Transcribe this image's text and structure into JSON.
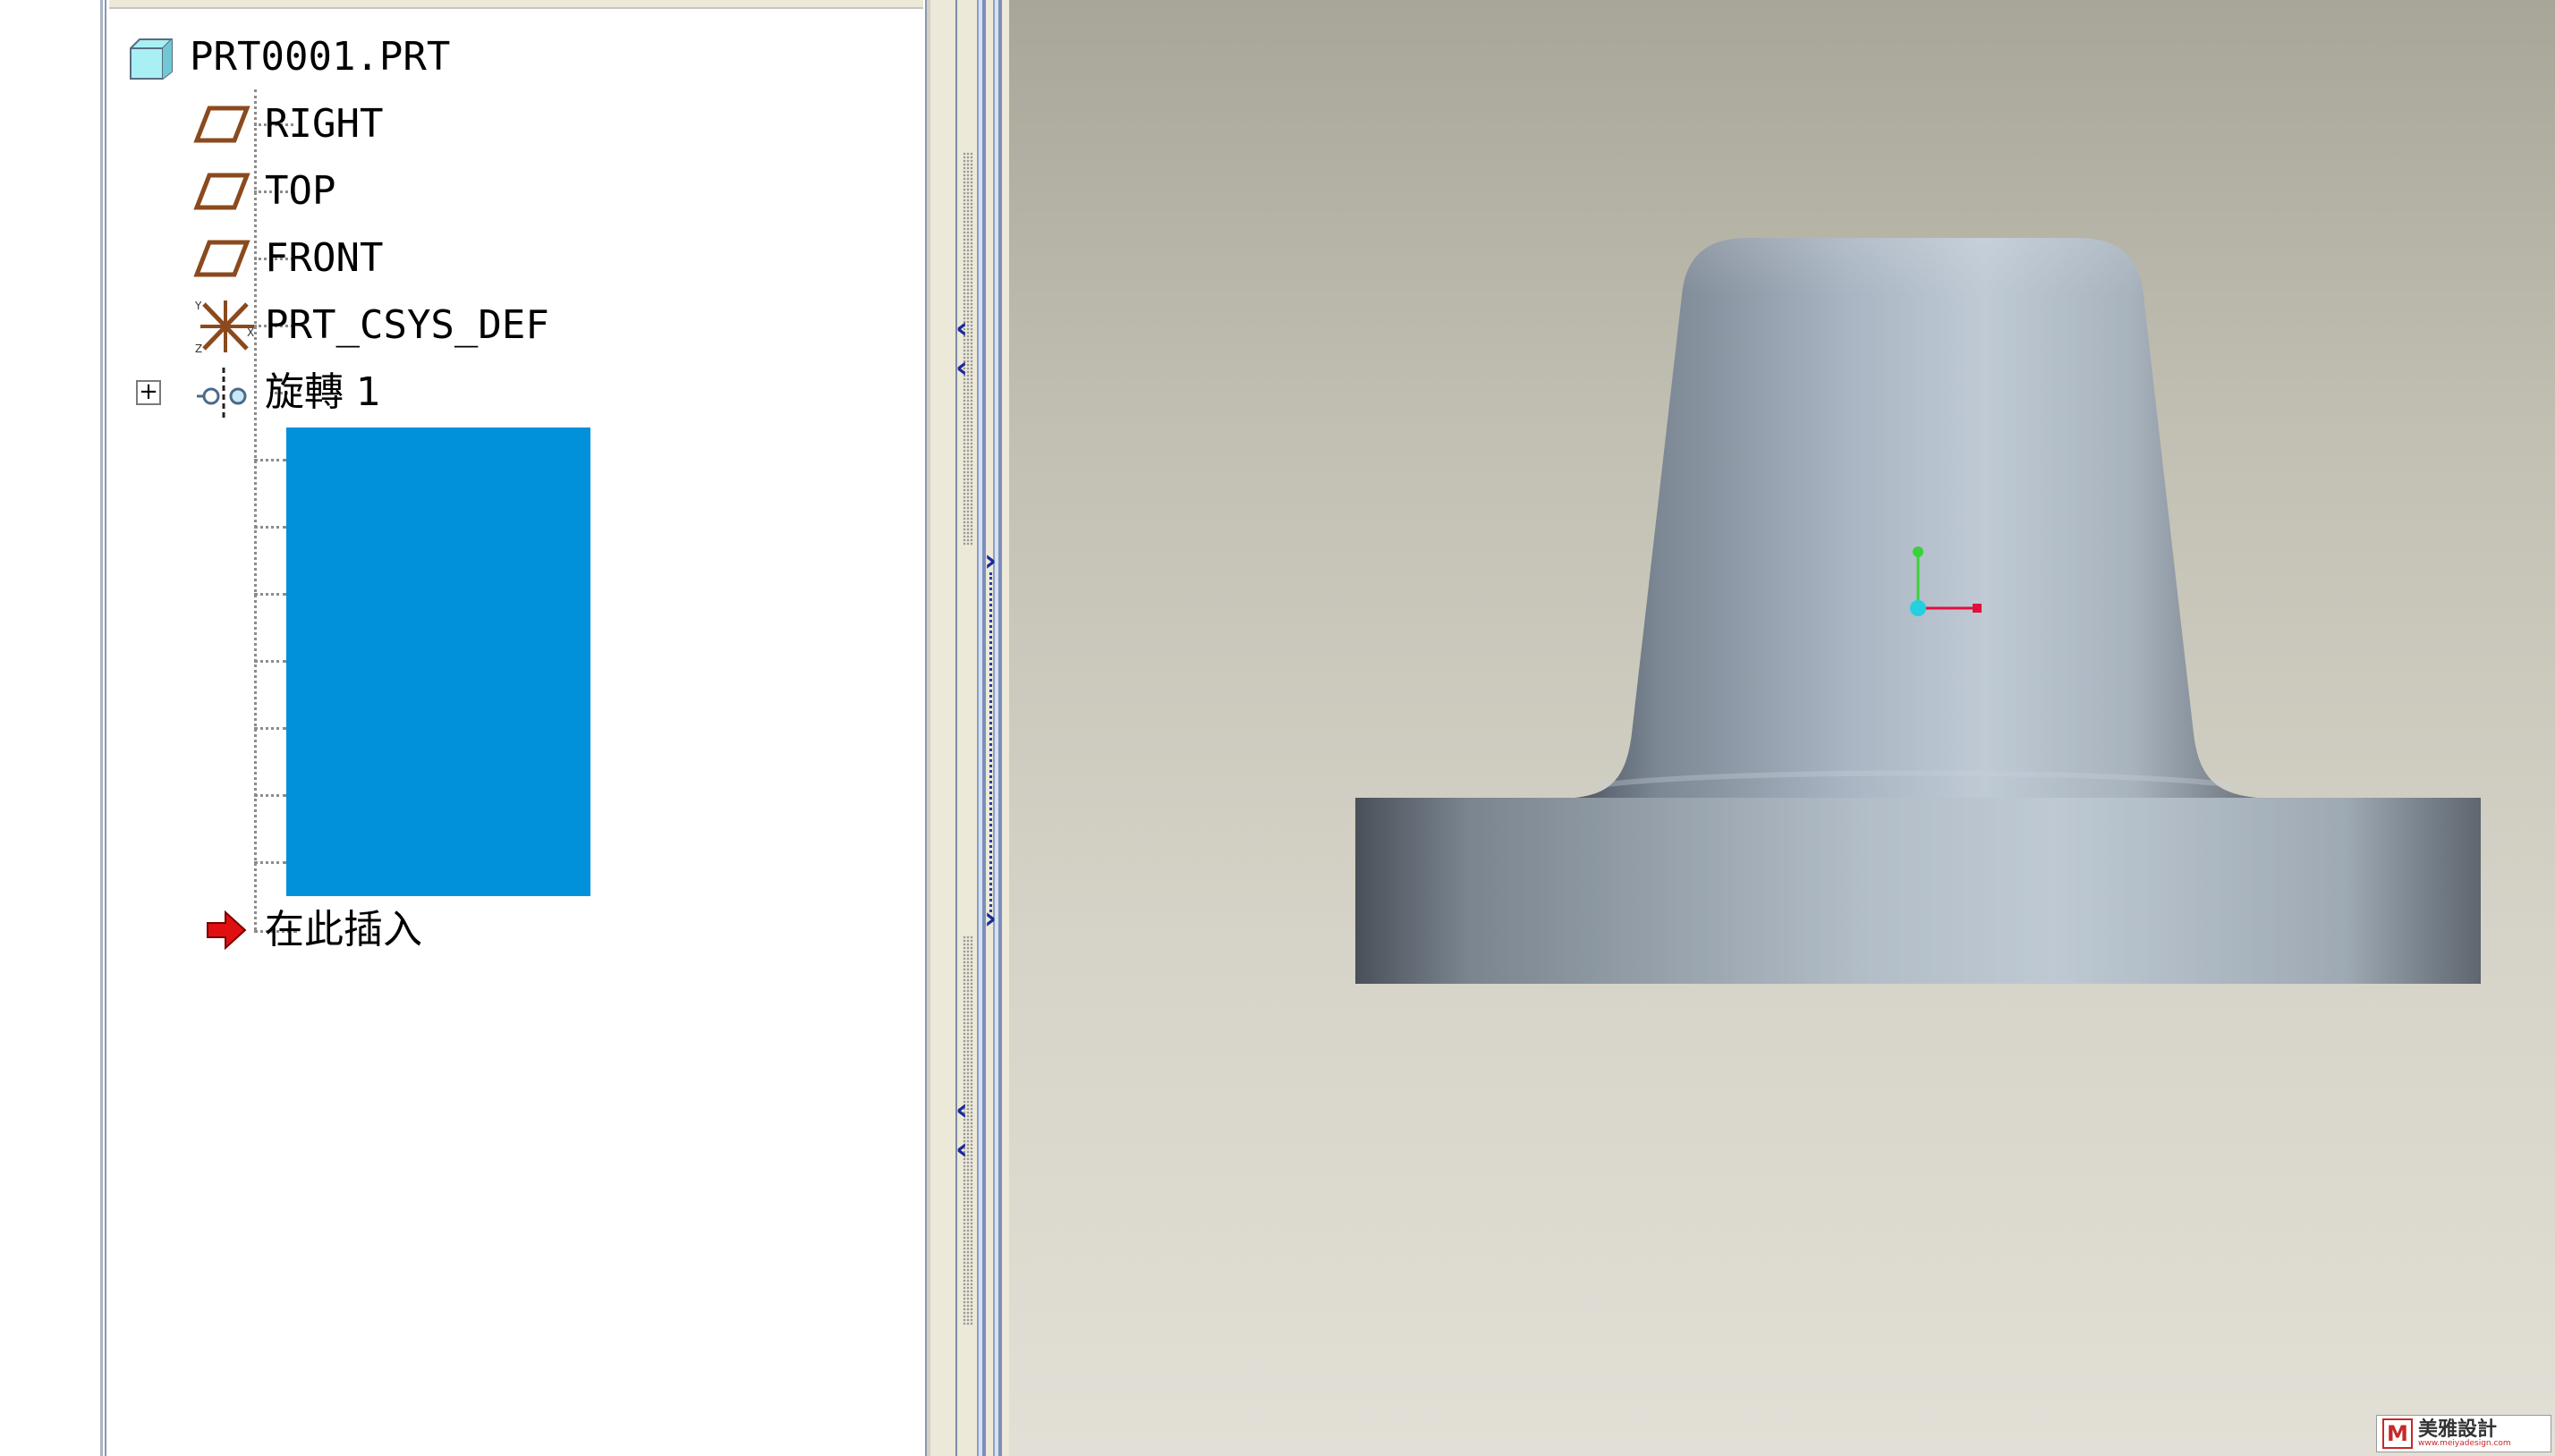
{
  "model_tree": {
    "root": {
      "label": "PRT0001.PRT",
      "icon": "part-cube-icon"
    },
    "items": [
      {
        "label": "RIGHT",
        "icon": "datum-plane-icon"
      },
      {
        "label": "TOP",
        "icon": "datum-plane-icon"
      },
      {
        "label": "FRONT",
        "icon": "datum-plane-icon"
      },
      {
        "label": "PRT_CSYS_DEF",
        "icon": "coordinate-system-icon"
      },
      {
        "label": "旋轉 1",
        "icon": "revolve-feature-icon",
        "expand_symbol": "+"
      }
    ],
    "insert_here": {
      "label": "在此插入",
      "icon": "insert-arrow-icon"
    },
    "selection_color": "#0091da"
  },
  "viewport": {
    "model": "revolved-part",
    "background_top": "#a8a699",
    "background_bottom": "#e2e0d6",
    "triad_colors": {
      "x": "#e0103a",
      "y": "#3ad23a",
      "origin": "#22d0e0"
    }
  },
  "watermark": {
    "logo_glyph": "M",
    "title": "美雅設計",
    "url": "www.meiyadesign.com"
  }
}
